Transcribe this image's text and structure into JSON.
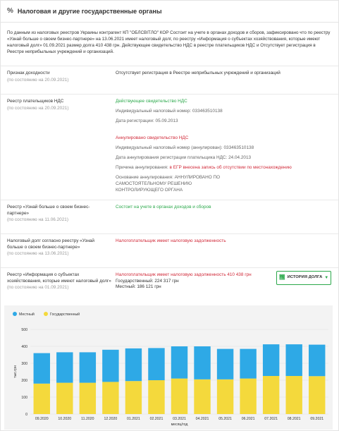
{
  "header": {
    "icon_glyph": "%",
    "title": "Налоговая и другие государственные органы"
  },
  "intro": "По данным из налоговых реестров Украины контрагент КП \"ОБЛСВІТЛО\" КОР Состоит на учете в органах доходов и сборов, зафиксировано что по реестру «Узнай больше о своем бизнес-партнере» на 13.06.2021 имеет налоговый долг, по реестру «Информация о субъектах хозяйствования, которые имеют налоговый долг» 01.09.2021 размер долга 410 438 грн. Действующее свидетельство НДС в реестре плательщиков НДС и Отсутствует регистрация в Реестре неприбыльных учреждений и организаций.",
  "rows": {
    "income": {
      "label": "Признак доходности",
      "date": "(по состоянию на 20.09.2021)",
      "value": "Отсутствует регистрация в Реестре неприбыльных учреждений и организаций"
    },
    "vat": {
      "label": "Реестр плательщиков НДС",
      "date": "(по состоянию на 20.09.2021)",
      "active_status": "Действующее свидетельство НДС",
      "active_tax_number": "Индивидуальный налоговый номер: 033463510138",
      "active_reg_date": "Дата регистрации: 05.09.2013",
      "annulled_status": "Аннулировано свидетельство НДС",
      "annulled_tax_number": "Индивидуальный налоговый номер (аннулирован): 033463510138",
      "annulled_date": "Дата аннулирования регистрации плательщика НДС: 24.04.2013",
      "annul_reason_prefix": "Причина аннулирования: ",
      "annul_reason": "в ЕГР внесена запись об отсутствии по местонахождению",
      "annul_basis": "Основание аннулирования: АННУЛИРОВАНО ПО САМОСТОЯТЕЛЬНОМУ РЕШЕНИЮ КОНТРОЛИРУЮЩЕГО ОРГАНА"
    },
    "partner": {
      "label": "Реестр «Узнай больше о своем бизнес-партнере»",
      "date": "(по состоянию на 11.06.2021)",
      "value": "Состоит на учете в органах доходов и сборов"
    },
    "debt_partner": {
      "label": "Налоговый долг согласно реестру «Узнай больше о своем бизнес-партнере»",
      "date": "(по состоянию на 13.06.2021)",
      "value": "Налогоплательщик имеет налоговую задолженность"
    },
    "debt_info": {
      "label": "Реестр «Информация о субъектах хозяйствования, которые имеют налоговый долг»",
      "date": "(по состоянию на 01.09.2021)",
      "value": "Налогоплательщик имеет налоговую задолженность 410 438 грн",
      "state_debt": "Государственный: 224 317 грн",
      "local_debt": "Местный: 186 121 грн",
      "history_button": "ИСТОРИЯ ДОЛГА"
    }
  },
  "colors": {
    "green": "#2aa84a",
    "red": "#d12b3a",
    "local": "#2ea9e6",
    "state": "#f4d93c"
  },
  "chart_data": {
    "type": "bar",
    "stacked": true,
    "categories": [
      "09.2020",
      "10.2020",
      "11.2020",
      "12.2020",
      "01.2021",
      "02.2021",
      "03.2021",
      "04.2021",
      "05.2021",
      "06.2021",
      "07.2021",
      "08.2021",
      "09.2021"
    ],
    "series": [
      {
        "name": "Государственный",
        "color": "#f4d93c",
        "values": [
          180,
          185,
          185,
          190,
          195,
          200,
          210,
          205,
          205,
          210,
          225,
          225,
          224
        ]
      },
      {
        "name": "Местный",
        "color": "#2ea9e6",
        "values": [
          180,
          180,
          180,
          190,
          193,
          190,
          190,
          195,
          180,
          175,
          187,
          187,
          186
        ]
      }
    ],
    "legend": [
      "Местный",
      "Государственный"
    ],
    "legend_position": "top-left",
    "xlabel": "месяц/год",
    "ylabel": "тыс.грн",
    "yticks": [
      0,
      100,
      200,
      300,
      400,
      500
    ],
    "ylim": [
      0,
      500
    ],
    "grid": true
  }
}
